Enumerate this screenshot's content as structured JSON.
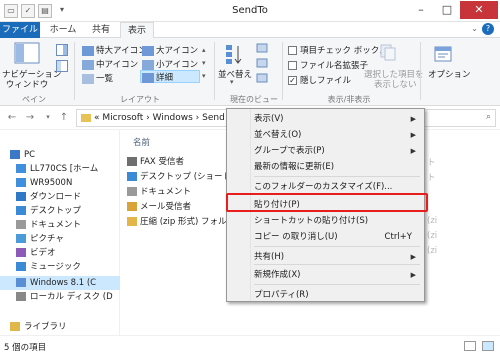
{
  "window": {
    "title": "SendTo"
  },
  "tabs": [
    {
      "label": "ファイル"
    },
    {
      "label": "ホーム"
    },
    {
      "label": "共有"
    },
    {
      "label": "表示"
    }
  ],
  "ribbon": {
    "pane_group": {
      "nav_pane": "ナビゲーション",
      "nav_pane2": "ウィンドウ",
      "label": "ペイン"
    },
    "layout_group": {
      "items": [
        "特大アイコン",
        "大アイコン",
        "中アイコン",
        "小アイコン",
        "一覧",
        "詳細"
      ],
      "label": "レイアウト"
    },
    "view_group": {
      "sort": "並べ替え",
      "label": "現在のビュー"
    },
    "show_group": {
      "item_checkboxes": "項目チェック ボックス",
      "file_ext": "ファイル名拡張子",
      "hidden_files": "隠しファイル",
      "hide_selected": "選択した項目を",
      "hide_selected2": "表示しない",
      "label": "表示/非表示"
    },
    "options": "オプション"
  },
  "address": {
    "crumbs": "« Microsoft › Windows › Send"
  },
  "nav_pane": [
    {
      "label": "PC",
      "color": "#3b79c8"
    },
    {
      "label": "LL770CS [ホーム",
      "color": "#3f8fdd"
    },
    {
      "label": "WR9500N",
      "color": "#3f8fdd"
    },
    {
      "label": "ダウンロード",
      "color": "#2f78c8"
    },
    {
      "label": "デスクトップ",
      "color": "#3b8ad6"
    },
    {
      "label": "ドキュメント",
      "color": "#9a9a9a"
    },
    {
      "label": "ピクチャ",
      "color": "#4c9bd9"
    },
    {
      "label": "ビデオ",
      "color": "#8c5bb8"
    },
    {
      "label": "ミュージック",
      "color": "#3b8ad6"
    },
    {
      "label": "Windows 8.1 (C",
      "color": "#5a8fd6"
    },
    {
      "label": "ローカル ディスク (D",
      "color": "#888888"
    },
    {
      "label": "ライブラリ",
      "color": "#e0b84a"
    }
  ],
  "list": {
    "header": "名前",
    "items": [
      {
        "label": "FAX 受信者",
        "color": "#6f6f6f"
      },
      {
        "label": "デスクトップ (ショートカットを",
        "color": "#3b8ad6"
      },
      {
        "label": "ドキュメント",
        "color": "#9a9a9a"
      },
      {
        "label": "メール受信者",
        "color": "#d9a33a"
      },
      {
        "label": "圧縮 (zip 形式) フォルダー",
        "color": "#e3b64b"
      }
    ],
    "ghost_texts": [
      "ト",
      "ト",
      "(zi",
      "(zi",
      "(zi"
    ]
  },
  "status": {
    "text": "5 個の項目"
  },
  "context_menu": {
    "items": [
      {
        "label": "表示(V)",
        "submenu": true
      },
      {
        "label": "並べ替え(O)",
        "submenu": true
      },
      {
        "label": "グループで表示(P)",
        "submenu": true
      },
      {
        "label": "最新の情報に更新(E)"
      },
      {
        "label": "このフォルダーのカスタマイズ(F)..."
      },
      {
        "label": "貼り付け(P)"
      },
      {
        "label": "ショートカットの貼り付け(S)"
      },
      {
        "label": "コピー の取り消し(U)",
        "shortcut": "Ctrl+Y"
      },
      {
        "label": "共有(H)",
        "submenu": true
      },
      {
        "label": "新規作成(X)",
        "submenu": true
      },
      {
        "label": "プロパティ(R)"
      }
    ]
  },
  "colors": {
    "accent": "#1a6cbb",
    "highlight_box": "#e81e1e",
    "close_button": "#c7343a"
  }
}
